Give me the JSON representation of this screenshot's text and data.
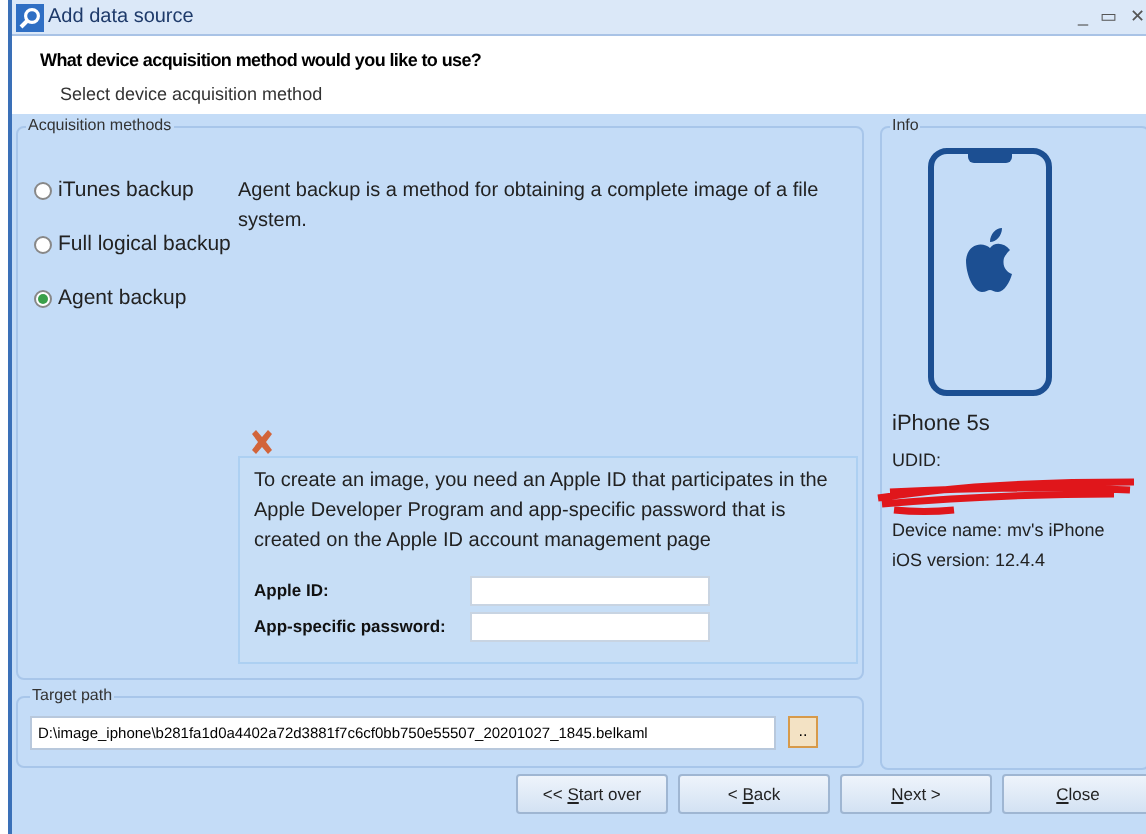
{
  "window": {
    "title": "Add data source",
    "controls": [
      "_",
      "▭",
      "✕"
    ]
  },
  "header": {
    "title": "What device acquisition method would you like to use?",
    "subtitle": "Select device acquisition method"
  },
  "acquisition_methods": {
    "label": "Acquisition methods",
    "options": [
      {
        "label": "iTunes backup",
        "selected": false
      },
      {
        "label": "Full logical backup",
        "selected": false
      },
      {
        "label": "Agent backup",
        "selected": true
      }
    ],
    "description": "Agent backup is a method for obtaining a complete image of a file system.",
    "notice": {
      "text": "To create an image, you need an Apple ID that participates in the Apple Developer Program and app-specific password that is created on the Apple ID account management page",
      "fields": [
        {
          "label": "Apple ID:"
        },
        {
          "label": "App-specific password:"
        }
      ]
    }
  },
  "target_path": {
    "label": "Target path",
    "value": "D:\\image_iphone\\b281fa1d0a4402a72d3881f7c6cf0bb750e55507_20201027_1845.belkaml",
    "browse": "..",
    "browse_focused": true
  },
  "info": {
    "label": "Info",
    "model": "iPhone 5s",
    "udid_label": "UDID:",
    "udid_redacted": true,
    "device_name": "Device name: mv's iPhone",
    "ios_version": "iOS version: 12.4.4"
  },
  "buttons": [
    {
      "prefix": "<< ",
      "key": "S",
      "rest": "tart over"
    },
    {
      "prefix": "< ",
      "key": "B",
      "rest": "ack"
    },
    {
      "key": "N",
      "rest": "ext >"
    },
    {
      "key": "C",
      "rest": "lose"
    }
  ]
}
